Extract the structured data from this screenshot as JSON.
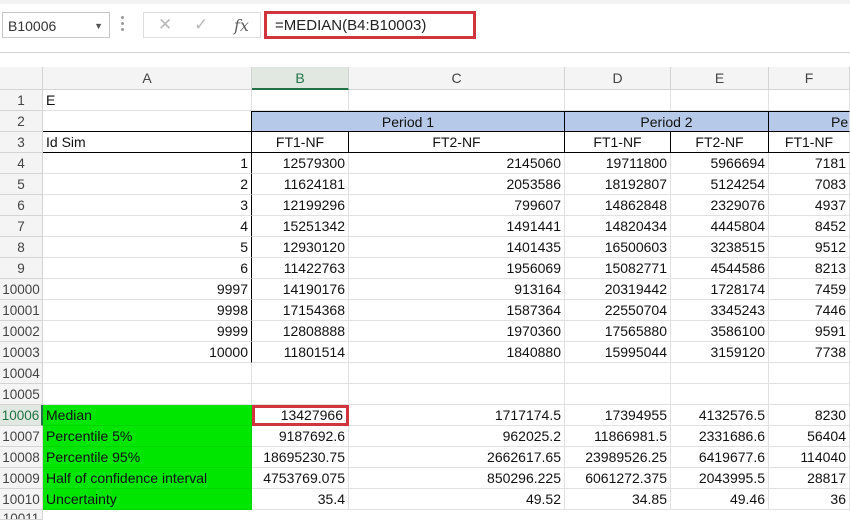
{
  "formula_bar": {
    "name_box": "B10006",
    "cancel_icon": "✕",
    "enter_icon": "✓",
    "fx_label": "fx",
    "formula": "=MEDIAN(B4:B10003)"
  },
  "columns": [
    "A",
    "B",
    "C",
    "D",
    "E",
    "F"
  ],
  "rows": {
    "r1": {
      "num": "1",
      "A": "E"
    },
    "r2": {
      "num": "2",
      "period1": "Period 1",
      "period2": "Period 2",
      "period3": "Pe"
    },
    "r3": {
      "num": "3",
      "A": "Id Sim",
      "B": "FT1-NF",
      "C": "FT2-NF",
      "D": "FT1-NF",
      "E": "FT2-NF",
      "F": "FT1-NF"
    },
    "data": [
      {
        "num": "4",
        "A": "1",
        "B": "12579300",
        "C": "2145060",
        "D": "19711800",
        "E": "5966694",
        "F": "7181"
      },
      {
        "num": "5",
        "A": "2",
        "B": "11624181",
        "C": "2053586",
        "D": "18192807",
        "E": "5124254",
        "F": "7083"
      },
      {
        "num": "6",
        "A": "3",
        "B": "12199296",
        "C": "799607",
        "D": "14862848",
        "E": "2329076",
        "F": "4937"
      },
      {
        "num": "7",
        "A": "4",
        "B": "15251342",
        "C": "1491441",
        "D": "14820434",
        "E": "4445804",
        "F": "8452"
      },
      {
        "num": "8",
        "A": "5",
        "B": "12930120",
        "C": "1401435",
        "D": "16500603",
        "E": "3238515",
        "F": "9512"
      },
      {
        "num": "9",
        "A": "6",
        "B": "11422763",
        "C": "1956069",
        "D": "15082771",
        "E": "4544586",
        "F": "8213"
      },
      {
        "num": "10000",
        "A": "9997",
        "B": "14190176",
        "C": "913164",
        "D": "20319442",
        "E": "1728174",
        "F": "7459"
      },
      {
        "num": "10001",
        "A": "9998",
        "B": "17154368",
        "C": "1587364",
        "D": "22550704",
        "E": "3345243",
        "F": "7446"
      },
      {
        "num": "10002",
        "A": "9999",
        "B": "12808888",
        "C": "1970360",
        "D": "17565880",
        "E": "3586100",
        "F": "9591"
      },
      {
        "num": "10003",
        "A": "10000",
        "B": "11801514",
        "C": "1840880",
        "D": "15995044",
        "E": "3159120",
        "F": "7738"
      }
    ],
    "r10004": {
      "num": "10004"
    },
    "r10005": {
      "num": "10005"
    },
    "stats": [
      {
        "num": "10006",
        "A": "Median",
        "B": "13427966",
        "C": "1717174.5",
        "D": "17394955",
        "E": "4132576.5",
        "F": "8230"
      },
      {
        "num": "10007",
        "A": "Percentile 5%",
        "B": "9187692.6",
        "C": "962025.2",
        "D": "11866981.5",
        "E": "2331686.6",
        "F": "56404"
      },
      {
        "num": "10008",
        "A": "Percentile 95%",
        "B": "18695230.75",
        "C": "2662617.65",
        "D": "23989526.25",
        "E": "6419677.6",
        "F": "114040"
      },
      {
        "num": "10009",
        "A": "Half of confidence interval",
        "B": "4753769.075",
        "C": "850296.225",
        "D": "6061272.375",
        "E": "2043995.5",
        "F": "28817"
      },
      {
        "num": "10010",
        "A": "Uncertainty",
        "B": "35.4",
        "C": "49.52",
        "D": "34.85",
        "E": "49.46",
        "F": "36"
      }
    ],
    "r10011": {
      "num": "10011"
    }
  },
  "colors": {
    "header_fill": "#b7c9e8",
    "stats_fill": "#00e600",
    "highlight": "#d0343d"
  }
}
